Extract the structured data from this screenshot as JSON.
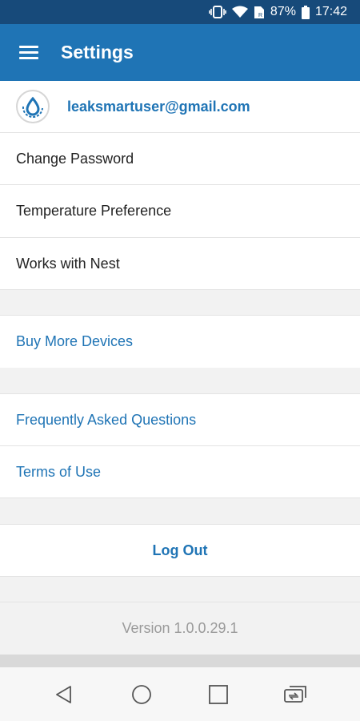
{
  "status_bar": {
    "battery_percent": "87%",
    "time": "17:42"
  },
  "app_bar": {
    "title": "Settings"
  },
  "account": {
    "email": "leaksmartuser@gmail.com"
  },
  "account_items": [
    {
      "label": "Change Password"
    },
    {
      "label": "Temperature Preference"
    },
    {
      "label": "Works with Nest"
    }
  ],
  "shop": {
    "buy_more_devices": "Buy More Devices"
  },
  "help": {
    "faq": "Frequently Asked Questions",
    "terms": "Terms of Use"
  },
  "logout": {
    "label": "Log Out"
  },
  "version": {
    "text": "Version 1.0.0.29.1"
  },
  "colors": {
    "status_bar": "#174a7a",
    "app_bar": "#1f74b5",
    "accent": "#1f74b5"
  }
}
